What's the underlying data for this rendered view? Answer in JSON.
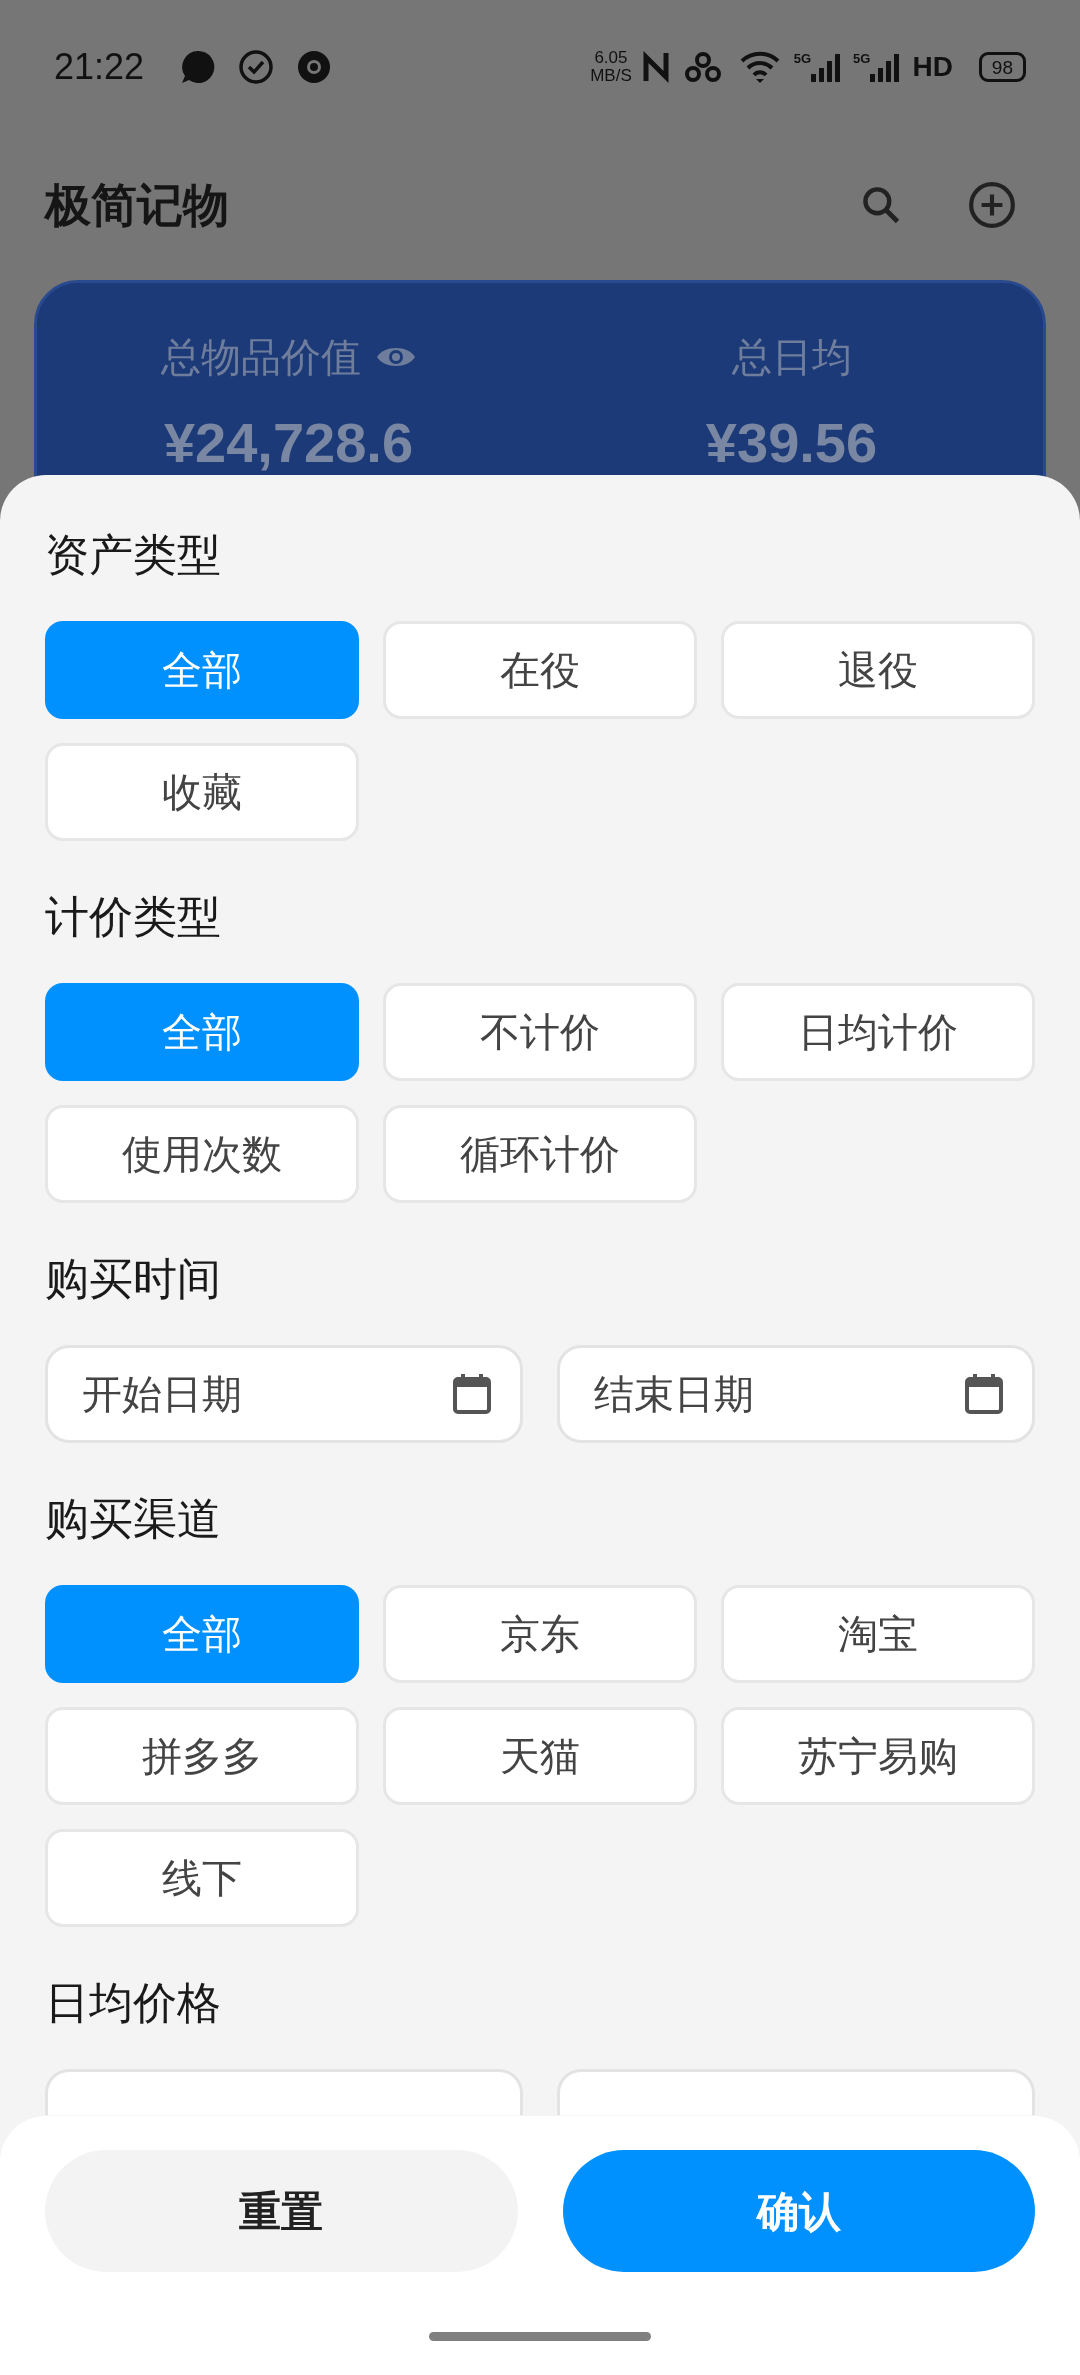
{
  "status_bar": {
    "time": "21:22",
    "speed_value": "6.05",
    "speed_unit": "MB/S",
    "sim_1": "5G",
    "sim_2": "5G",
    "hd": "HD",
    "battery": "98"
  },
  "header": {
    "title": "极简记物"
  },
  "summary_card": {
    "stats": [
      {
        "label": "总物品价值",
        "value": "¥24,728.6",
        "eye": true
      },
      {
        "label": "总日均",
        "value": "¥39.56",
        "eye": false
      }
    ]
  },
  "filter_sheet": {
    "sections": [
      {
        "kind": "chips",
        "title": "资产类型",
        "options": [
          {
            "label": "全部",
            "selected": true
          },
          {
            "label": "在役",
            "selected": false
          },
          {
            "label": "退役",
            "selected": false
          },
          {
            "label": "收藏",
            "selected": false
          }
        ]
      },
      {
        "kind": "chips",
        "title": "计价类型",
        "options": [
          {
            "label": "全部",
            "selected": true
          },
          {
            "label": "不计价",
            "selected": false
          },
          {
            "label": "日均计价",
            "selected": false
          },
          {
            "label": "使用次数",
            "selected": false
          },
          {
            "label": "循环计价",
            "selected": false
          }
        ]
      },
      {
        "kind": "dates",
        "title": "购买时间",
        "fields": [
          {
            "placeholder": "开始日期"
          },
          {
            "placeholder": "结束日期"
          }
        ]
      },
      {
        "kind": "chips",
        "title": "购买渠道",
        "options": [
          {
            "label": "全部",
            "selected": true
          },
          {
            "label": "京东",
            "selected": false
          },
          {
            "label": "淘宝",
            "selected": false
          },
          {
            "label": "拼多多",
            "selected": false
          },
          {
            "label": "天猫",
            "selected": false
          },
          {
            "label": "苏宁易购",
            "selected": false
          },
          {
            "label": "线下",
            "selected": false
          }
        ]
      },
      {
        "kind": "range",
        "title": "日均价格"
      }
    ],
    "buttons": [
      {
        "label": "重置",
        "kind": "secondary"
      },
      {
        "label": "确认",
        "kind": "primary"
      }
    ]
  }
}
